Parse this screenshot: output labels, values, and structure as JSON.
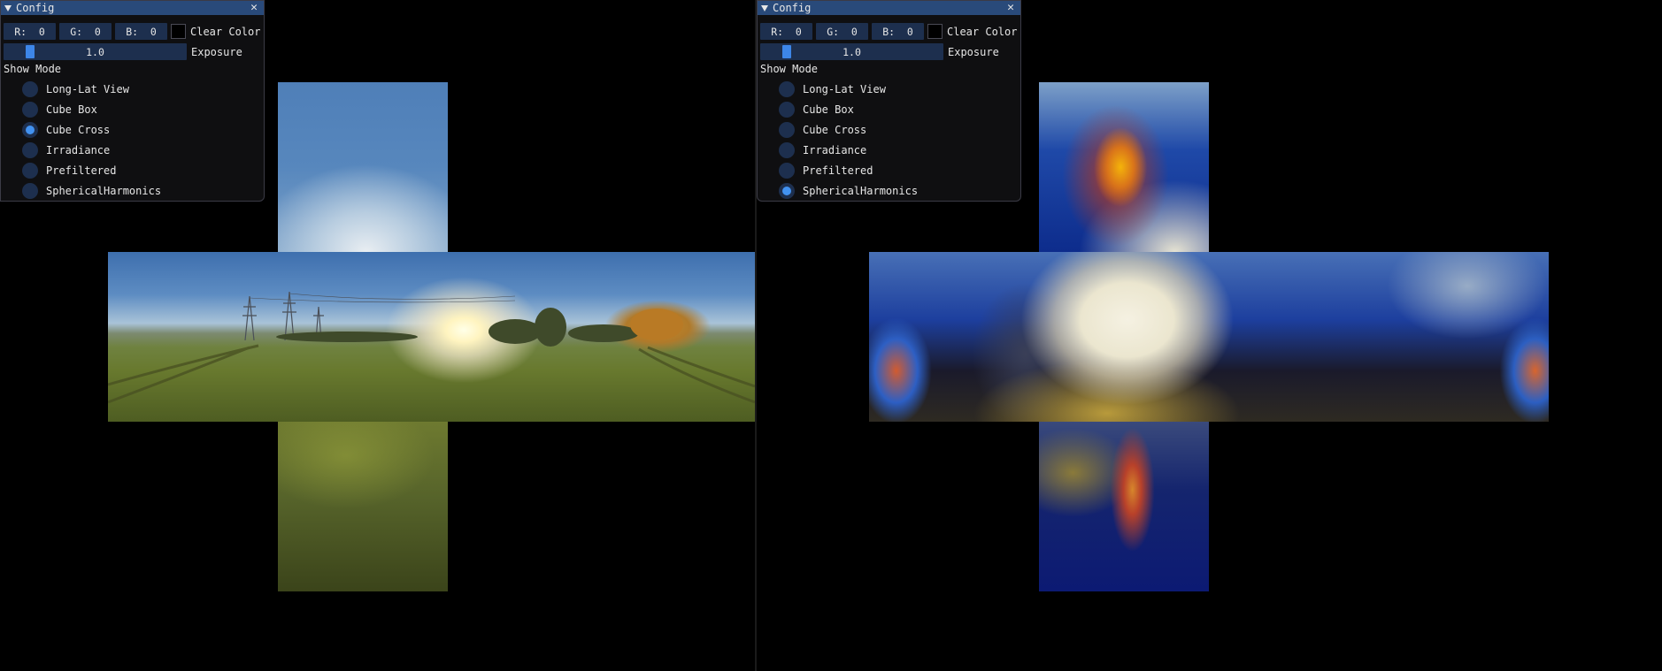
{
  "left_panel": {
    "window": {
      "title": "Config",
      "close_glyph": "✕"
    },
    "clear_color": {
      "r": "R:  0",
      "g": "G:  0",
      "b": "B:  0",
      "swatch_color": "#000000",
      "label": "Clear Color"
    },
    "exposure": {
      "value": "1.0",
      "fraction": 0.12,
      "label": "Exposure"
    },
    "show_mode": {
      "label": "Show Mode",
      "options": [
        "Long-Lat View",
        "Cube Box",
        "Cube Cross",
        "Irradiance",
        "Prefiltered",
        "SphericalHarmonics"
      ],
      "selected": "Cube Cross"
    }
  },
  "right_panel": {
    "window": {
      "title": "Config",
      "close_glyph": "✕"
    },
    "clear_color": {
      "r": "R:  0",
      "g": "G:  0",
      "b": "B:  0",
      "swatch_color": "#000000",
      "label": "Clear Color"
    },
    "exposure": {
      "value": "1.0",
      "fraction": 0.12,
      "label": "Exposure"
    },
    "show_mode": {
      "label": "Show Mode",
      "options": [
        "Long-Lat View",
        "Cube Box",
        "Cube Cross",
        "Irradiance",
        "Prefiltered",
        "SphericalHarmonics"
      ],
      "selected": "SphericalHarmonics"
    }
  },
  "theme": {
    "title_bar": "#294a7a",
    "frame_bg": "#1d2f4e",
    "accent": "#4292f0",
    "window_bg": "#101012"
  },
  "viewports": {
    "left_content": "Cube Cross environment map (meadow with power lines at sunrise)",
    "right_content": "Spherical harmonics lighting cube cross"
  }
}
